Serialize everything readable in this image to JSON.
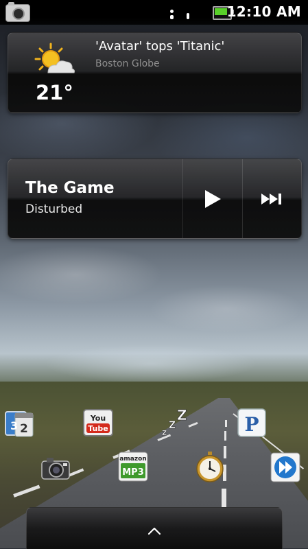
{
  "status_bar": {
    "time": "12:10 AM",
    "icons": [
      "camera-notification-icon",
      "signal-dots-icon",
      "battery-icon"
    ],
    "battery_color": "#59d02a"
  },
  "weather_widget": {
    "temperature": "21°",
    "condition_icon": "partly-sunny-icon",
    "headline": "'Avatar' tops 'Titanic'",
    "source": "Boston Globe"
  },
  "music_widget": {
    "title": "The Game",
    "artist": "Disturbed",
    "controls": [
      "play-icon",
      "skip-next-icon"
    ]
  },
  "home_icons": [
    {
      "name": "calendar-app-icon"
    },
    {
      "name": "youtube-app-icon",
      "text_line1": "You",
      "text_line2": "Tube"
    },
    {
      "name": "sleep-zzz-icon",
      "text": "Z"
    },
    {
      "name": "pandora-app-icon",
      "text": "P"
    },
    {
      "name": "camera-app-icon"
    },
    {
      "name": "amazon-mp3-app-icon",
      "text_line1": "amazon",
      "text_line2": "MP3"
    },
    {
      "name": "alarm-clock-app-icon"
    },
    {
      "name": "media-player-app-icon"
    }
  ],
  "calendar_digits": [
    "3",
    "2"
  ],
  "drawer_handle": {
    "icon": "chevron-up-icon"
  },
  "colors": {
    "widget_bg": "#1a1a1a",
    "source_gray": "#8f8f8f",
    "youtube_red": "#d42a1c",
    "amazon_green": "#3f9a2c",
    "pandora_blue": "#2a5fa8",
    "player_blue": "#2277cc"
  }
}
